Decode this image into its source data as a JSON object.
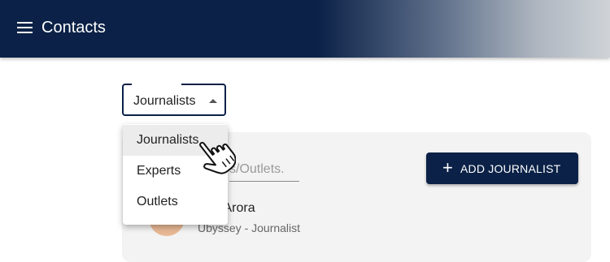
{
  "appbar": {
    "title": "Contacts",
    "menu_icon": "hamburger-menu-icon",
    "color": "#0b2147"
  },
  "type_select": {
    "value": "Journalists",
    "options": [
      "Journalists",
      "Experts",
      "Outlets"
    ],
    "highlighted": "Journalists"
  },
  "search": {
    "placeholder": "s/Outlets."
  },
  "actions": {
    "add_label": "ADD JOURNALIST",
    "add_icon": "plus-icon"
  },
  "contacts": [
    {
      "name": "a Arora",
      "subtitle": "Ubyssey - Journalist",
      "avatar_color": "#e8b895"
    }
  ],
  "cursor": "pointing-hand-cursor-icon"
}
